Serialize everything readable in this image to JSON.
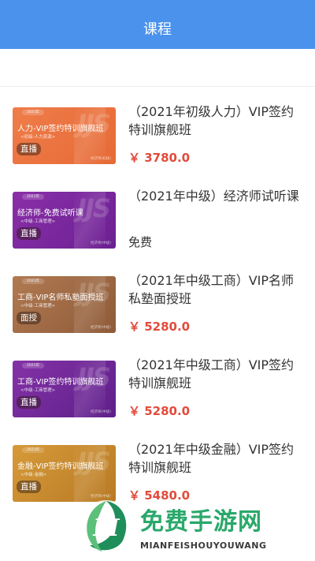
{
  "header": {
    "title": "课程"
  },
  "courses": [
    {
      "title": "（2021年初级人力）VIP签约特训旗舰班",
      "price": "￥ 3780.0",
      "thumb": {
        "year": "2021年",
        "name": "人力-VIP签约特训旗舰班",
        "sub": "<初级-人力资源>",
        "tag": "直播",
        "footer": "经济师(初级)",
        "watermark": "JJS",
        "color1": "#ef7d4a",
        "color2": "#e66a36"
      }
    },
    {
      "title": "（2021年中级）经济师试听课",
      "price": "免费",
      "thumb": {
        "year": "2021年",
        "name": "经济师-免费试听课",
        "sub": "<中级-工商管理>",
        "tag": "直播",
        "footer": "经济师(中级)",
        "watermark": "JJS",
        "color1": "#8a2fa8",
        "color2": "#6b2092"
      }
    },
    {
      "title": "（2021年中级工商）VIP名师私塾面授班",
      "price": "￥ 5280.0",
      "thumb": {
        "year": "2021年",
        "name": "工商-VIP名师私塾面授班",
        "sub": "<中级-工商管理>",
        "tag": "面授",
        "footer": "经济师(中级)",
        "watermark": "JJS",
        "color1": "#b07a52",
        "color2": "#8e5a38"
      }
    },
    {
      "title": "（2021年中级工商）VIP签约特训旗舰班",
      "price": "￥ 5280.0",
      "thumb": {
        "year": "2021年",
        "name": "工商-VIP签约特训旗舰班",
        "sub": "<中级-工商管理>",
        "tag": "直播",
        "footer": "经济师(中级)",
        "watermark": "JJS",
        "color1": "#8432a6",
        "color2": "#5e1f8a"
      }
    },
    {
      "title": "（2021年中级金融）VIP签约特训旗舰班",
      "price": "￥ 5480.0",
      "thumb": {
        "year": "2021年",
        "name": "金融-VIP签约特训旗舰班",
        "sub": "<中级-金融>",
        "tag": "直播",
        "footer": "经济师(中级)",
        "watermark": "JJS",
        "color1": "#d69a3a",
        "color2": "#b97a24"
      }
    }
  ],
  "watermark": {
    "cn": "免费手游网",
    "en": "MIANFEISHOUYOUWANG"
  },
  "colors": {
    "header": "#4a92ec",
    "price": "#e24b3b",
    "brand": "#2aa86b"
  }
}
